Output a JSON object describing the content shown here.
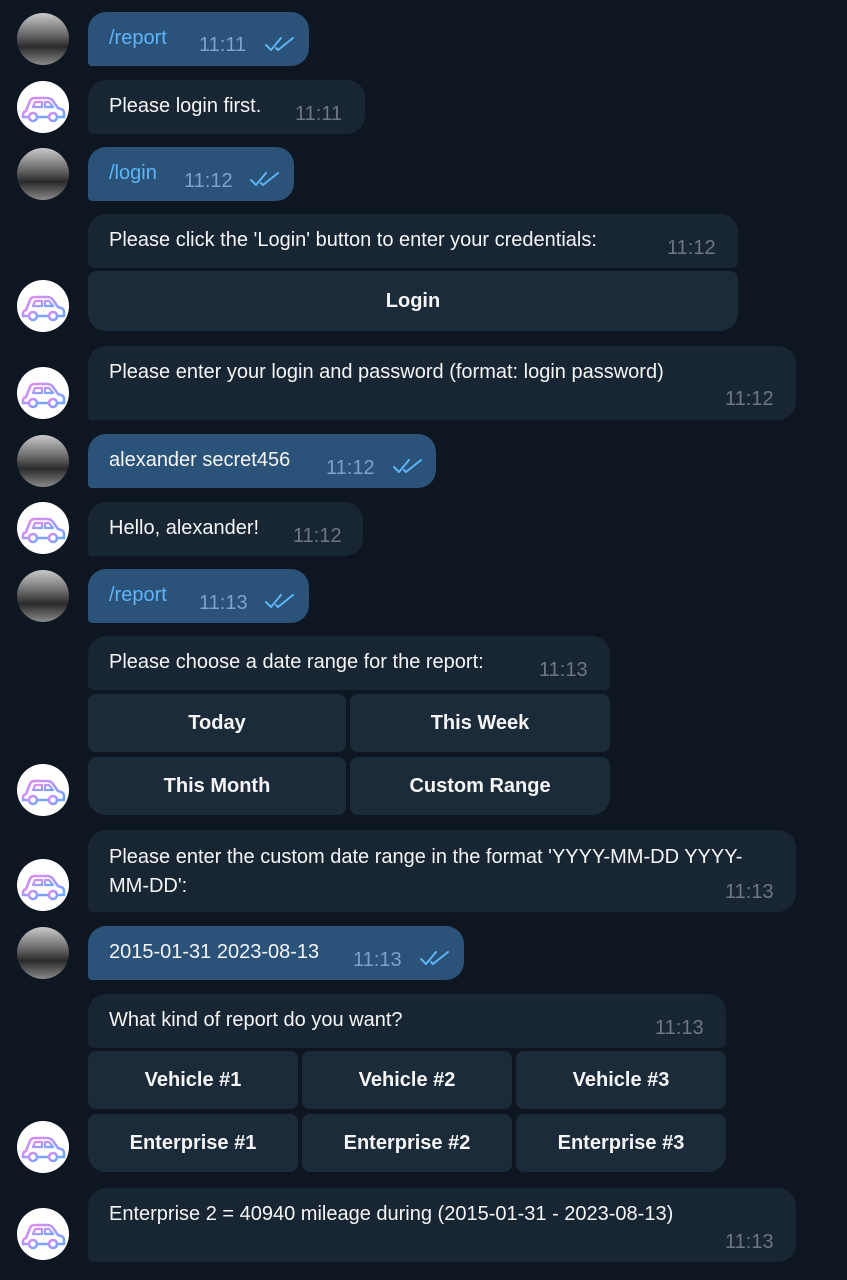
{
  "chat": {
    "m1": {
      "text": "/report",
      "time": "11:11"
    },
    "m2": {
      "text": "Please login first.",
      "time": "11:11"
    },
    "m3": {
      "text": "/login",
      "time": "11:12"
    },
    "m4": {
      "text": "Please click the 'Login' button to enter your credentials:",
      "time": "11:12",
      "buttons": [
        "Login"
      ]
    },
    "m5": {
      "text": "Please enter your login and password (format: login password)",
      "time": "11:12"
    },
    "m6": {
      "text": "alexander secret456",
      "time": "11:12"
    },
    "m7": {
      "text": "Hello, alexander!",
      "time": "11:12"
    },
    "m8": {
      "text": "/report",
      "time": "11:13"
    },
    "m9": {
      "text": "Please choose a date range for the report:",
      "time": "11:13",
      "buttons": [
        "Today",
        "This Week",
        "This Month",
        "Custom Range"
      ]
    },
    "m10": {
      "text": "Please enter the custom date range in the format 'YYYY-MM-DD YYYY-MM-DD':",
      "time": "11:13"
    },
    "m11": {
      "text": "2015-01-31 2023-08-13",
      "time": "11:13"
    },
    "m12": {
      "text": "What kind of report do you want?",
      "time": "11:13",
      "buttons": [
        "Vehicle #1",
        "Vehicle #2",
        "Vehicle #3",
        "Enterprise #1",
        "Enterprise #2",
        "Enterprise #3"
      ]
    },
    "m13": {
      "text": "Enterprise 2 = 40940 mileage during (2015-01-31 - 2023-08-13)",
      "time": "11:13"
    }
  },
  "colors": {
    "background": "#0e1621",
    "outgoing": "#2b5278",
    "incoming": "#182533",
    "link": "#5eb5f7",
    "button": "#1c2b3a"
  },
  "icons": {
    "read_receipt": "double-check-icon",
    "bot_avatar": "car-icon",
    "user_avatar": "user-photo"
  }
}
